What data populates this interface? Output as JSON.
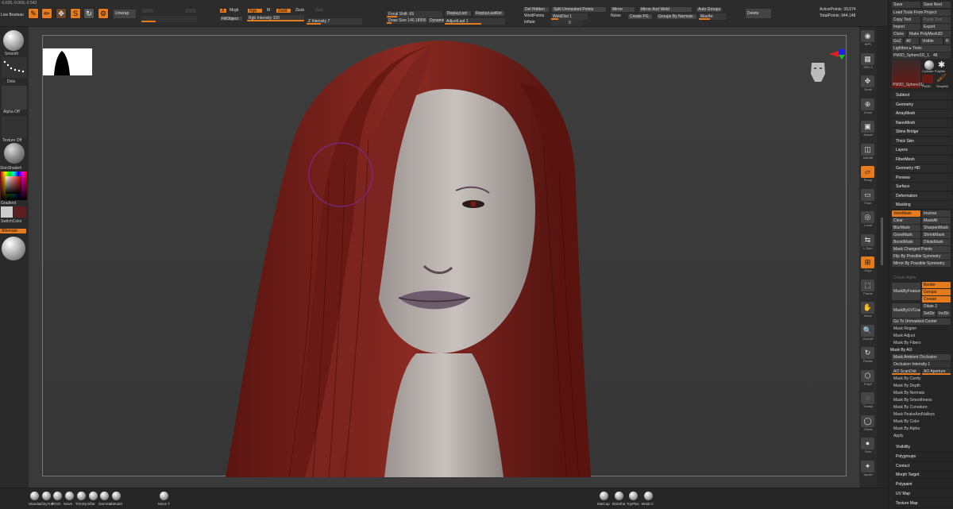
{
  "top": {
    "coords": "-0.605,-0.068,-0.543",
    "live_boolean": "Live Boolean",
    "unwrap": "Unwrap",
    "draw_buttons": [
      "Edit",
      "Draw",
      "Move",
      "Scale",
      "Rotate"
    ],
    "mrgb": "Mrgb",
    "rgb": "Rgb",
    "m": "M",
    "zadd": "Zadd",
    "zsub": "Zsub",
    "zcut": "Zcut",
    "a_label": "A",
    "fill_object": "FillObject",
    "rgb_intensity": "Rgb Intensity 100",
    "z_intensity": "Z Intensity 7",
    "focal_shift": "Focal Shift -65",
    "draw_size": "Draw Size 140.18995",
    "dynamic": "Dynamic",
    "replay_last": "ReplayLast",
    "replay_last_rel": "ReplayLastRel",
    "adjust_last": "AdjustLast 1",
    "del_hidden": "Del Hidden",
    "split_unmasked": "Split Unmasked Points",
    "weld_points": "WeldPoints",
    "weld_dist": "WeldDist 1",
    "inflate": "Inflate",
    "inflate_val": "0",
    "mirror": "Mirror",
    "mirror_and_weld": "Mirror And Weld",
    "auto_groups": "Auto Groups",
    "noise": "Noise",
    "create_pg": "Create PG",
    "groups_by_normals": "Groups By Normals",
    "maxang": "MaxAn",
    "delete": "Delete",
    "active_points": "ActivePoints: 39,574",
    "total_points": "TotalPoints: 944,148"
  },
  "left": {
    "smooth": "Smooth",
    "dots": "Dots",
    "alpha_off": "Alpha Off",
    "texture_off": "Texture Off",
    "material": "SkinShade4",
    "gradient": "Gradient",
    "switch_color": "SwitchColor",
    "alternate": "Alternate"
  },
  "bottom": {
    "brushes": [
      "Standar",
      "ClayTub",
      "Pinch",
      "Move",
      "TrimDy",
      "Inflat",
      "DamSta",
      "ZModel"
    ],
    "move_t": "Move T",
    "materials": [
      "MatCap",
      "SkinSha",
      "ToyPlas",
      "Metal C"
    ]
  },
  "rightshelf": [
    "BPR",
    "SPix 3",
    "Scroll",
    "Zoom",
    "Actual",
    "AAHalf",
    "Persp",
    "Floor",
    "Local",
    "L.Sym",
    "Gxyz",
    "Frame",
    "Move",
    "ZoomD",
    "Rotate",
    "PolyF",
    "Transp",
    "Ghost",
    "Solo",
    "Xpose"
  ],
  "panel": {
    "save": "Save",
    "save_next": "Save Next",
    "load_tools": "Load Tools From Project",
    "copy_tool": "Copy Tool",
    "paste_tool": "Paste Tool",
    "import": "Import",
    "export": "Export",
    "clone": "Clone",
    "make_polymesh": "Make PolyMesh3D",
    "goz": "GoZ",
    "all": "All",
    "visible": "Visible",
    "r": "R",
    "lightbox_tools": "Lightbox ▸ Tools",
    "tool_name": "PM3D_Sphere3D_1.",
    "tool_count": "48",
    "thumbs": [
      "PM3D_Sphere3D",
      "Cylinder PolyMe",
      "PM3D",
      "SimpleB"
    ],
    "menus": [
      "Subtool",
      "Geometry",
      "ArrayMesh",
      "NanoMesh",
      "Slime Bridge",
      "Thick Skin",
      "Layers",
      "FiberMesh",
      "Geometry HD",
      "Preview",
      "Surface",
      "Deformation",
      "Masking"
    ],
    "masking": {
      "viewmask": "ViewMask",
      "inverse": "Inverse",
      "clear": "Clear",
      "mask_all": "MaskAll",
      "blur": "BlurMask",
      "sharpen": "SharpenMask",
      "grow": "GrowMask",
      "shrink": "ShrinkMask",
      "boost": "BoostMask",
      "dilute": "DiluteMask",
      "mask_changed": "Mask Changed Points",
      "flip_sym": "Flip By Possible Symmetry",
      "mirror_sym": "Mirror By Possible Symmetry",
      "create_alpha": "Create Alpha",
      "mask_by_feature": "MaskByFeature",
      "border": "Border",
      "groups": "Groups",
      "crease": "Crease",
      "mask_by_uvcrack": "MaskByUVCrack",
      "dilate": "Dilate",
      "dilate_val": "2",
      "set_dir": "SetDir",
      "inv_dir": "InvDir",
      "go_unmasked": "Go To Unmasked Center",
      "mask_region": "Mask Region",
      "mask_adjust": "Mask Adjust",
      "mask_fibers": "Mask By Fibers",
      "mask_ao": "Mask By AO",
      "mask_ambient": "Mask Ambient Occlusion",
      "occ_intensity": "Occlusion Intensity 1",
      "ao_scandist": "AO ScanDist",
      "ao_aperture": "AO Aperture",
      "items": [
        "Mask By Cavity",
        "Mask By Depth",
        "Mask By Normals",
        "Mask By Smoothness",
        "Mask By Curvature",
        "Mask PeaksAndValleys",
        "Mask By Color",
        "Mask By Alpha",
        "Apply"
      ]
    },
    "bottom_menus": [
      "Visibility",
      "Polygroups",
      "Contact",
      "Morph Target",
      "Polypaint",
      "UV Map",
      "Texture Map"
    ]
  }
}
